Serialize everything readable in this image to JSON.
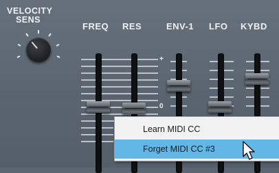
{
  "labels": {
    "velocity_sens": "VELOCITY\nSENS",
    "freq": "FREQ",
    "res": "RES",
    "env1": "ENV-1",
    "lfo": "LFO",
    "kybd": "KYBD"
  },
  "scale": {
    "plus": "+",
    "zero": "0"
  },
  "context_menu": {
    "items": [
      {
        "label": "Learn MIDI CC"
      },
      {
        "label": "Forget MIDI CC #3"
      }
    ],
    "highlighted_index": 1,
    "highlight_color": "#62b7e7"
  },
  "colors": {
    "panel": "#5f6a74",
    "label": "#eef2f5"
  }
}
